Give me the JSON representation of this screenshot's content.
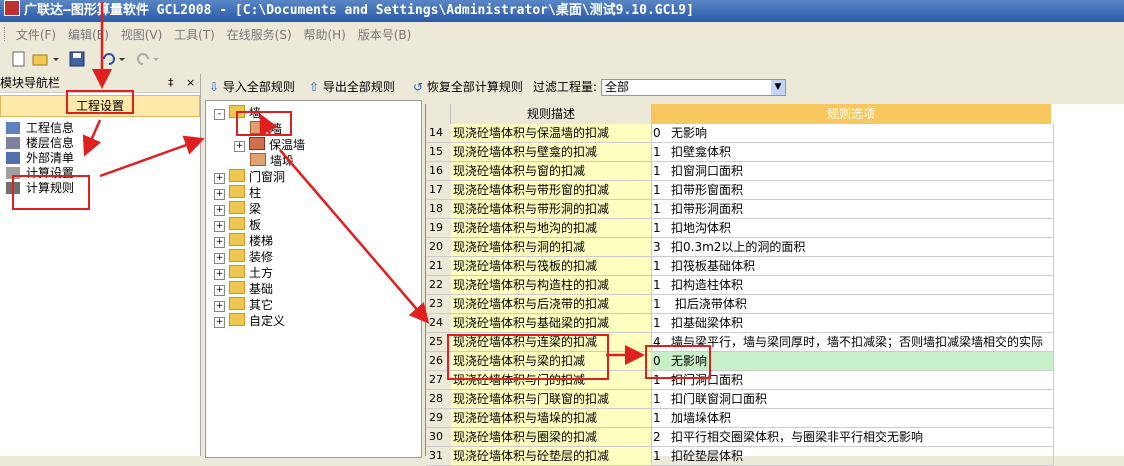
{
  "window": {
    "title": "广联达—图形算量软件 GCL2008 - [C:\\Documents and Settings\\Administrator\\桌面\\测试9.10.GCL9]"
  },
  "menu": {
    "items": [
      "文件(F)",
      "编辑(E)",
      "视图(V)",
      "工具(T)",
      "在线服务(S)",
      "帮助(H)",
      "版本号(B)"
    ]
  },
  "left_panel": {
    "title": "模块导航栏",
    "pin": "‡",
    "close": "×",
    "section": "工程设置",
    "items": [
      "工程信息",
      "楼层信息",
      "外部清单",
      "计算设置",
      "计算规则"
    ]
  },
  "rules_toolbar": {
    "import_all": "导入全部规则",
    "export_all": "导出全部规则",
    "restore_all": "恢复全部计算规则",
    "filter_label": "过滤工程量:",
    "filter_value": "全部"
  },
  "tree": {
    "nodes": [
      {
        "label": "墙",
        "level": 0,
        "state": "-"
      },
      {
        "label": "墙",
        "level": 1,
        "state": ""
      },
      {
        "label": "保温墙",
        "level": 1,
        "state": "+"
      },
      {
        "label": "墙垛",
        "level": 1,
        "state": ""
      },
      {
        "label": "门窗洞",
        "level": 0,
        "state": "+"
      },
      {
        "label": "柱",
        "level": 0,
        "state": "+"
      },
      {
        "label": "梁",
        "level": 0,
        "state": "+"
      },
      {
        "label": "板",
        "level": 0,
        "state": "+"
      },
      {
        "label": "楼梯",
        "level": 0,
        "state": "+"
      },
      {
        "label": "装修",
        "level": 0,
        "state": "+"
      },
      {
        "label": "土方",
        "level": 0,
        "state": "+"
      },
      {
        "label": "基础",
        "level": 0,
        "state": "+"
      },
      {
        "label": "其它",
        "level": 0,
        "state": "+"
      },
      {
        "label": "自定义",
        "level": 0,
        "state": "+"
      }
    ]
  },
  "grid": {
    "headers": [
      "规则描述",
      "规则选项"
    ],
    "rows": [
      {
        "num": "14",
        "desc": "现浇砼墙体积与保温墙的扣减",
        "code": "0",
        "opt": "无影响"
      },
      {
        "num": "15",
        "desc": "现浇砼墙体积与壁龛的扣减",
        "code": "1",
        "opt": "扣壁龛体积"
      },
      {
        "num": "16",
        "desc": "现浇砼墙体积与窗的扣减",
        "code": "1",
        "opt": "扣窗洞口面积"
      },
      {
        "num": "17",
        "desc": "现浇砼墙体积与带形窗的扣减",
        "code": "1",
        "opt": "扣带形窗面积"
      },
      {
        "num": "18",
        "desc": "现浇砼墙体积与带形洞的扣减",
        "code": "1",
        "opt": "扣带形洞面积"
      },
      {
        "num": "19",
        "desc": "现浇砼墙体积与地沟的扣减",
        "code": "1",
        "opt": "扣地沟体积"
      },
      {
        "num": "20",
        "desc": "现浇砼墙体积与洞的扣减",
        "code": "3",
        "opt": "扣0.3m2以上的洞的面积"
      },
      {
        "num": "21",
        "desc": "现浇砼墙体积与筏板的扣减",
        "code": "1",
        "opt": "扣筏板基础体积"
      },
      {
        "num": "22",
        "desc": "现浇砼墙体积与构造柱的扣减",
        "code": "1",
        "opt": "扣构造柱体积"
      },
      {
        "num": "23",
        "desc": "现浇砼墙体积与后浇带的扣减",
        "code": "1",
        "opt": " 扣后浇带体积"
      },
      {
        "num": "24",
        "desc": "现浇砼墙体积与基础梁的扣减",
        "code": "1",
        "opt": "扣基础梁体积"
      },
      {
        "num": "25",
        "desc": "现浇砼墙体积与连梁的扣减",
        "code": "4",
        "opt": "墙与梁平行，墙与梁同厚时，墙不扣减梁；否则墙扣减梁墙相交的实际"
      },
      {
        "num": "26",
        "desc": "现浇砼墙体积与梁的扣减",
        "code": "0",
        "opt": "无影响"
      },
      {
        "num": "27",
        "desc": "现浇砼墙体积与门的扣减",
        "code": "1",
        "opt": "扣门洞口面积"
      },
      {
        "num": "28",
        "desc": "现浇砼墙体积与门联窗的扣减",
        "code": "1",
        "opt": "扣门联窗洞口面积"
      },
      {
        "num": "29",
        "desc": "现浇砼墙体积与墙垛的扣减",
        "code": "1",
        "opt": "加墙垛体积"
      },
      {
        "num": "30",
        "desc": "现浇砼墙体积与圈梁的扣减",
        "code": "2",
        "opt": "扣平行相交圈梁体积，与圈梁非平行相交无影响"
      },
      {
        "num": "31",
        "desc": "现浇砼墙体积与砼垫层的扣减",
        "code": "1",
        "opt": "扣砼垫层体积"
      }
    ],
    "selected_row": 12
  },
  "colors": {
    "title_bar": "#2a5aa8",
    "desc_cell": "#ffffc0",
    "header_orange": "#f7c860",
    "selected_row": "#c8f0c8",
    "annotation": "#e02020"
  }
}
